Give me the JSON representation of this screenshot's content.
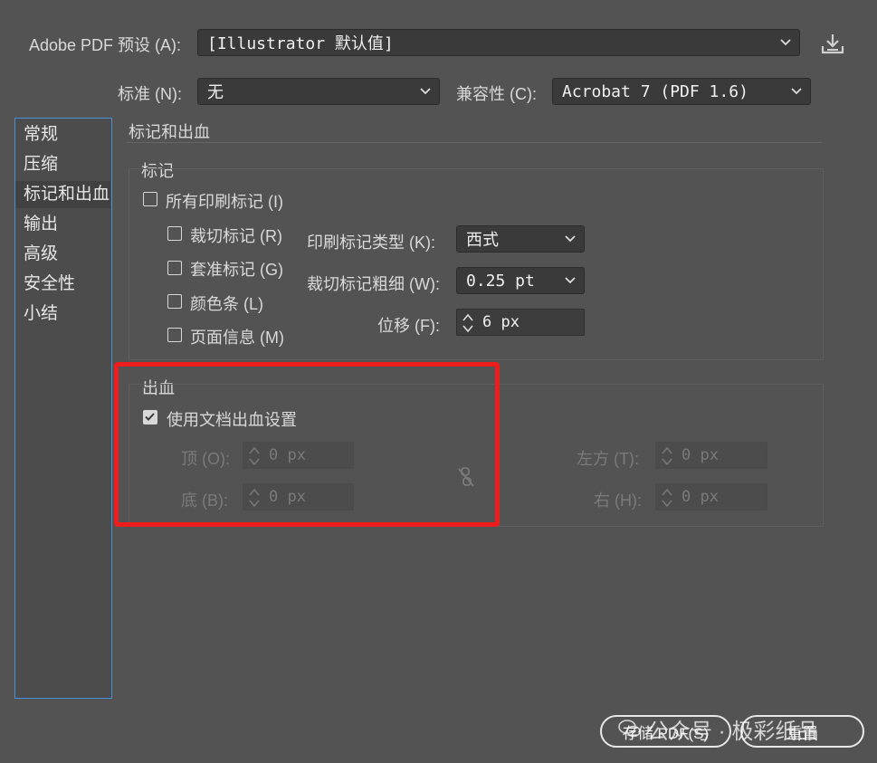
{
  "header": {
    "preset_label": "Adobe PDF 预设 (A):",
    "preset_value": "[Illustrator 默认值]",
    "standard_label": "标准 (N):",
    "standard_value": "无",
    "compat_label": "兼容性 (C):",
    "compat_value": "Acrobat 7 (PDF 1.6)"
  },
  "sidebar": {
    "items": [
      {
        "label": "常规"
      },
      {
        "label": "压缩"
      },
      {
        "label": "标记和出血"
      },
      {
        "label": "输出"
      },
      {
        "label": "高级"
      },
      {
        "label": "安全性"
      },
      {
        "label": "小结"
      }
    ]
  },
  "panel": {
    "title": "标记和出血",
    "marks": {
      "heading": "标记",
      "all_marks": "所有印刷标记 (I)",
      "trim_marks": "裁切标记 (R)",
      "registration_marks": "套准标记 (G)",
      "color_bars": "颜色条 (L)",
      "page_info": "页面信息 (M)",
      "mark_type_label": "印刷标记类型 (K):",
      "mark_type_value": "西式",
      "trim_weight_label": "裁切标记粗细 (W):",
      "trim_weight_value": "0.25 pt",
      "offset_label": "位移 (F):",
      "offset_value": "6 px"
    },
    "bleed": {
      "heading": "出血",
      "use_doc_bleed": "使用文档出血设置",
      "top_label": "顶 (O):",
      "top_value": "0 px",
      "bottom_label": "底 (B):",
      "bottom_value": "0 px",
      "left_label": "左方 (T):",
      "left_value": "0 px",
      "right_label": "右 (H):",
      "right_value": "0 px"
    }
  },
  "footer": {
    "save_label": "存储 PDF(S)",
    "reset_label": "重置",
    "watermark": "公众号 · 极彩纸品"
  },
  "colors": {
    "background": "#535353",
    "highlight_box": "#ee1d1d",
    "sidebar_border": "#4a8fd9"
  }
}
